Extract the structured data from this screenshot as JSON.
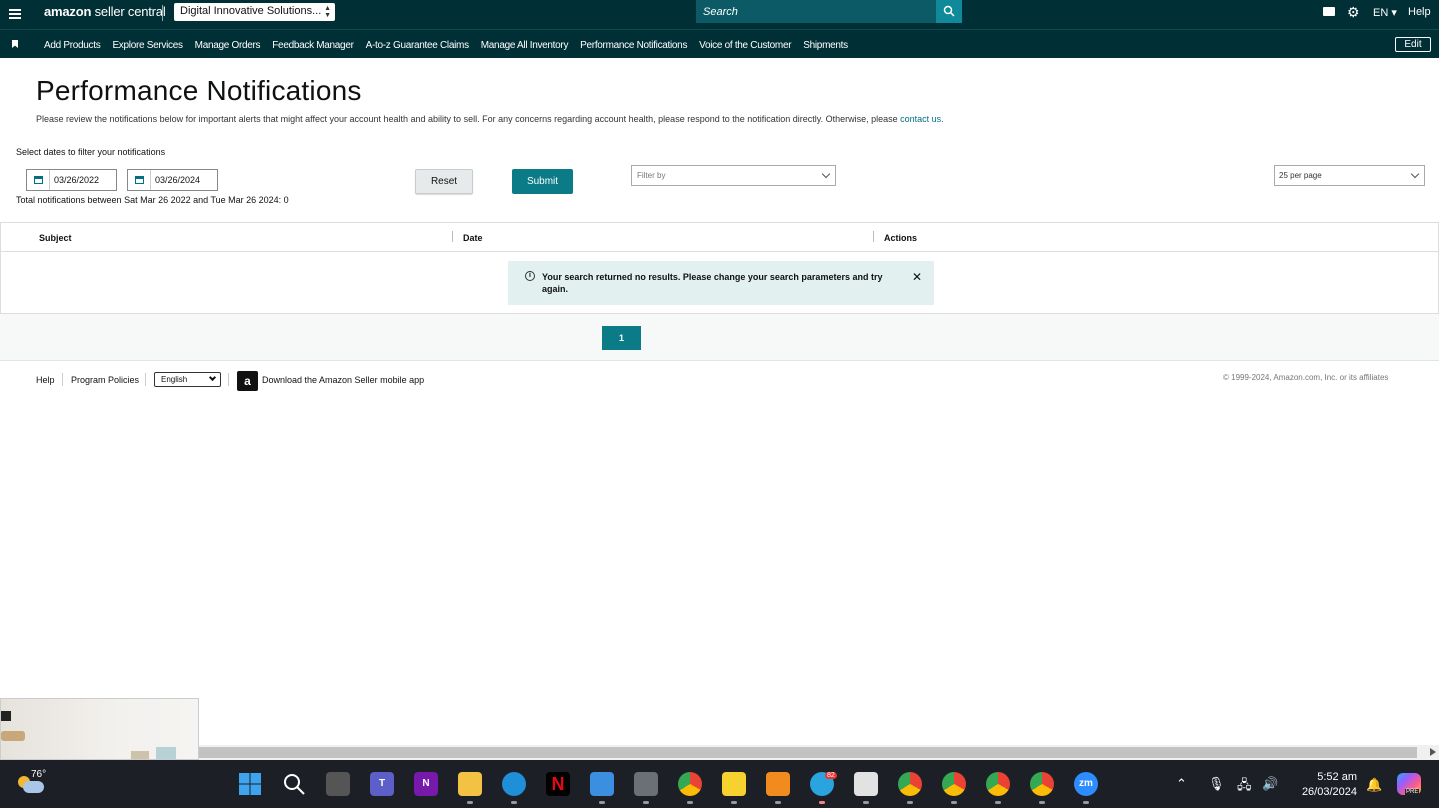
{
  "header": {
    "logo_brand": "amazon",
    "logo_text": "seller central",
    "account": "Digital Innovative Solutions...",
    "search_placeholder": "Search",
    "language": "EN ▾",
    "help": "Help"
  },
  "nav": {
    "items": [
      "Add Products",
      "Explore Services",
      "Manage Orders",
      "Feedback Manager",
      "A-to-z Guarantee Claims",
      "Manage All Inventory",
      "Performance Notifications",
      "Voice of the Customer",
      "Shipments"
    ],
    "edit": "Edit"
  },
  "page": {
    "title": "Performance Notifications",
    "intro": "Please review the notifications below for important alerts that might affect your account health and ability to sell. For any concerns regarding account health, please respond to the notification directly. Otherwise, please ",
    "intro_link": "contact us.",
    "select_label": "Select dates to filter your notifications",
    "start_date": "03/26/2022",
    "end_date": "03/26/2024",
    "total": "Total notifications between Sat Mar 26 2022 and Tue Mar 26 2024: 0",
    "reset": "Reset",
    "submit": "Submit",
    "filter_placeholder": "Filter by",
    "per_page": "25 per page"
  },
  "table": {
    "columns": [
      "Subject",
      "Date",
      "Actions"
    ],
    "alert": "Your search returned no results. Please change your search parameters and try again."
  },
  "pagination": {
    "current": "1"
  },
  "footer": {
    "help": "Help",
    "policies": "Program Policies",
    "language": "English",
    "app_icon_letter": "a",
    "app": "Download the Amazon Seller mobile app",
    "copyright": "© 1999-2024, Amazon.com, Inc. or its affiliates"
  },
  "taskbar": {
    "temperature": "76°",
    "time": "5:52 am",
    "date": "26/03/2024",
    "telegram_badge": "82",
    "zoom_label": "zm",
    "onenote_label": "N",
    "netflix_label": "N",
    "teams_label": "T",
    "copilot_label": "PRE"
  },
  "colors": {
    "header_bg": "#002f36",
    "accent": "#0a7b87",
    "alert_bg": "#e2f0f0"
  }
}
